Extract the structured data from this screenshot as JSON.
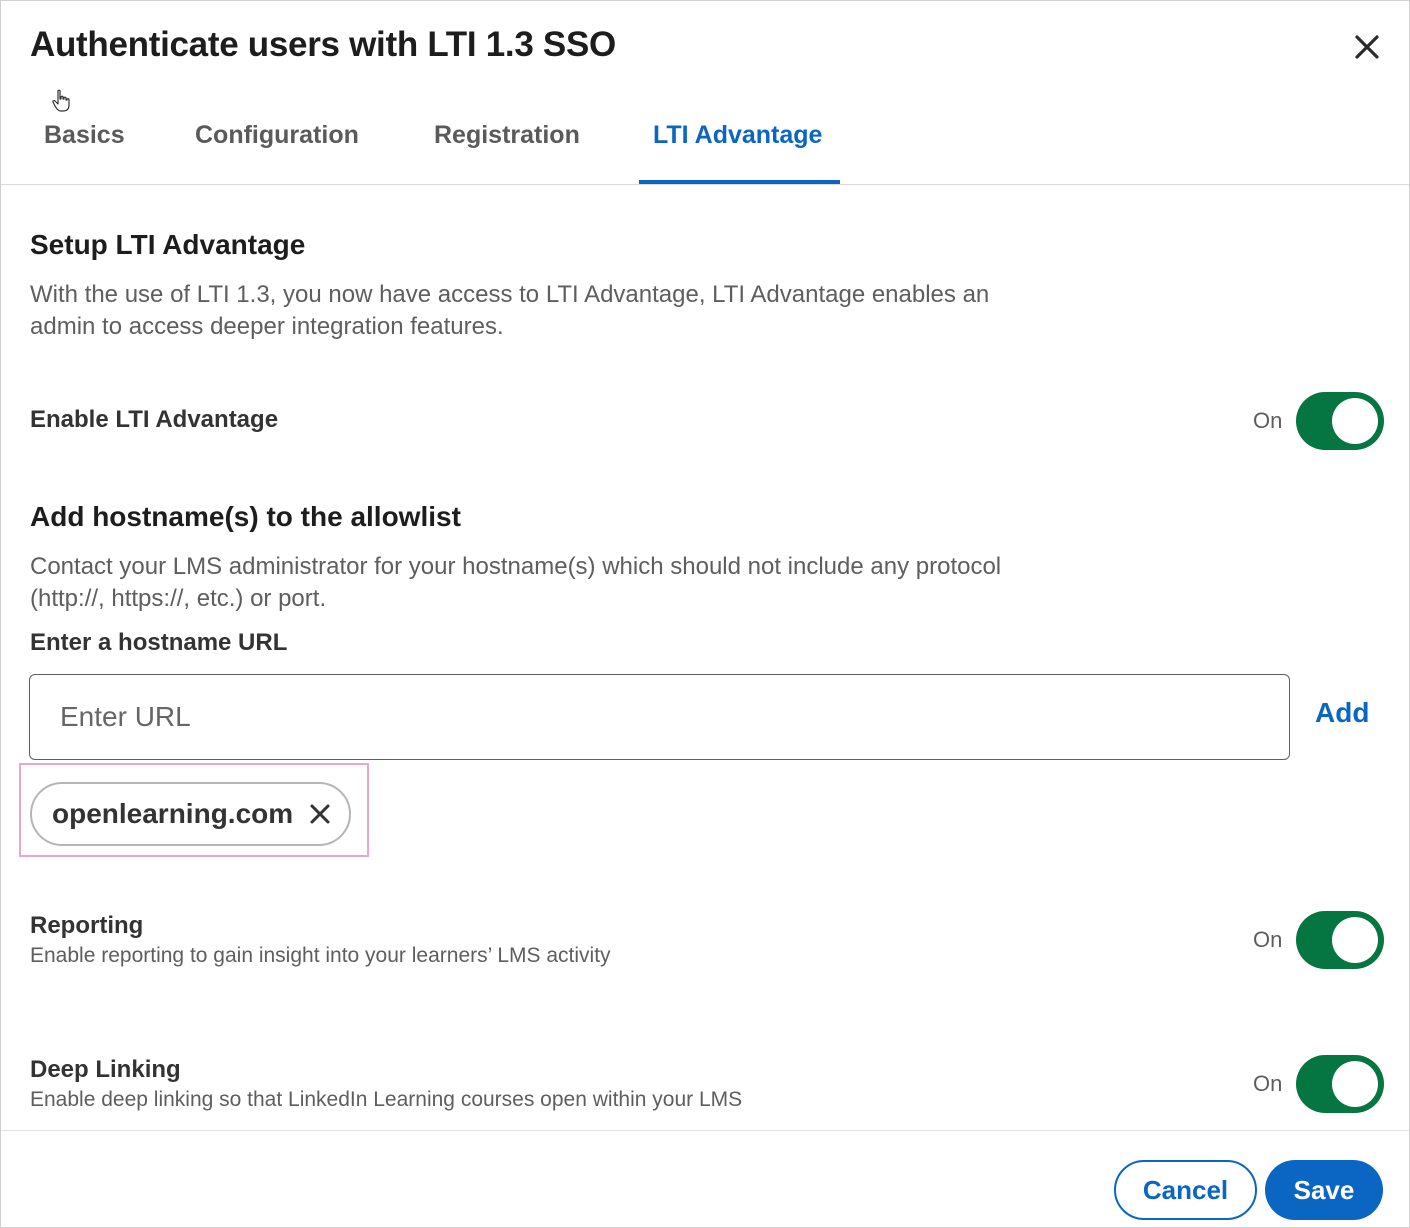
{
  "dialog": {
    "title": "Authenticate users with LTI 1.3 SSO"
  },
  "tabs": [
    {
      "label": "Basics",
      "active": false
    },
    {
      "label": "Configuration",
      "active": false
    },
    {
      "label": "Registration",
      "active": false
    },
    {
      "label": "LTI Advantage",
      "active": true
    }
  ],
  "setup": {
    "title": "Setup LTI Advantage",
    "description_line1": "With the use of LTI 1.3, you now have access to LTI Advantage, LTI Advantage enables an",
    "description_line2": "admin to access deeper integration features."
  },
  "enable_lti": {
    "label": "Enable LTI Advantage",
    "state_label": "On",
    "on": true
  },
  "allowlist": {
    "heading": "Add hostname(s) to the allowlist",
    "description_line1": "Contact your LMS administrator for your hostname(s) which should not include any protocol",
    "description_line2": "(http://, https://, etc.) or port.",
    "input_label": "Enter a hostname URL",
    "input_placeholder": "Enter URL",
    "input_value": "",
    "add_label": "Add",
    "hostnames": [
      "openlearning.com"
    ]
  },
  "reporting": {
    "label": "Reporting",
    "description": "Enable reporting to gain insight into your learners’ LMS activity",
    "state_label": "On",
    "on": true
  },
  "deep_linking": {
    "label": "Deep Linking",
    "description": "Enable deep linking so that LinkedIn Learning courses open within your LMS",
    "state_label": "On",
    "on": true
  },
  "footer": {
    "cancel_label": "Cancel",
    "save_label": "Save"
  },
  "colors": {
    "accent": "#0a66c2",
    "toggle_on": "#057642",
    "highlight": "#e5a9cf"
  },
  "icons": {
    "close": "close-icon",
    "chip_remove": "close-icon",
    "cursor": "hand-pointer-icon"
  }
}
